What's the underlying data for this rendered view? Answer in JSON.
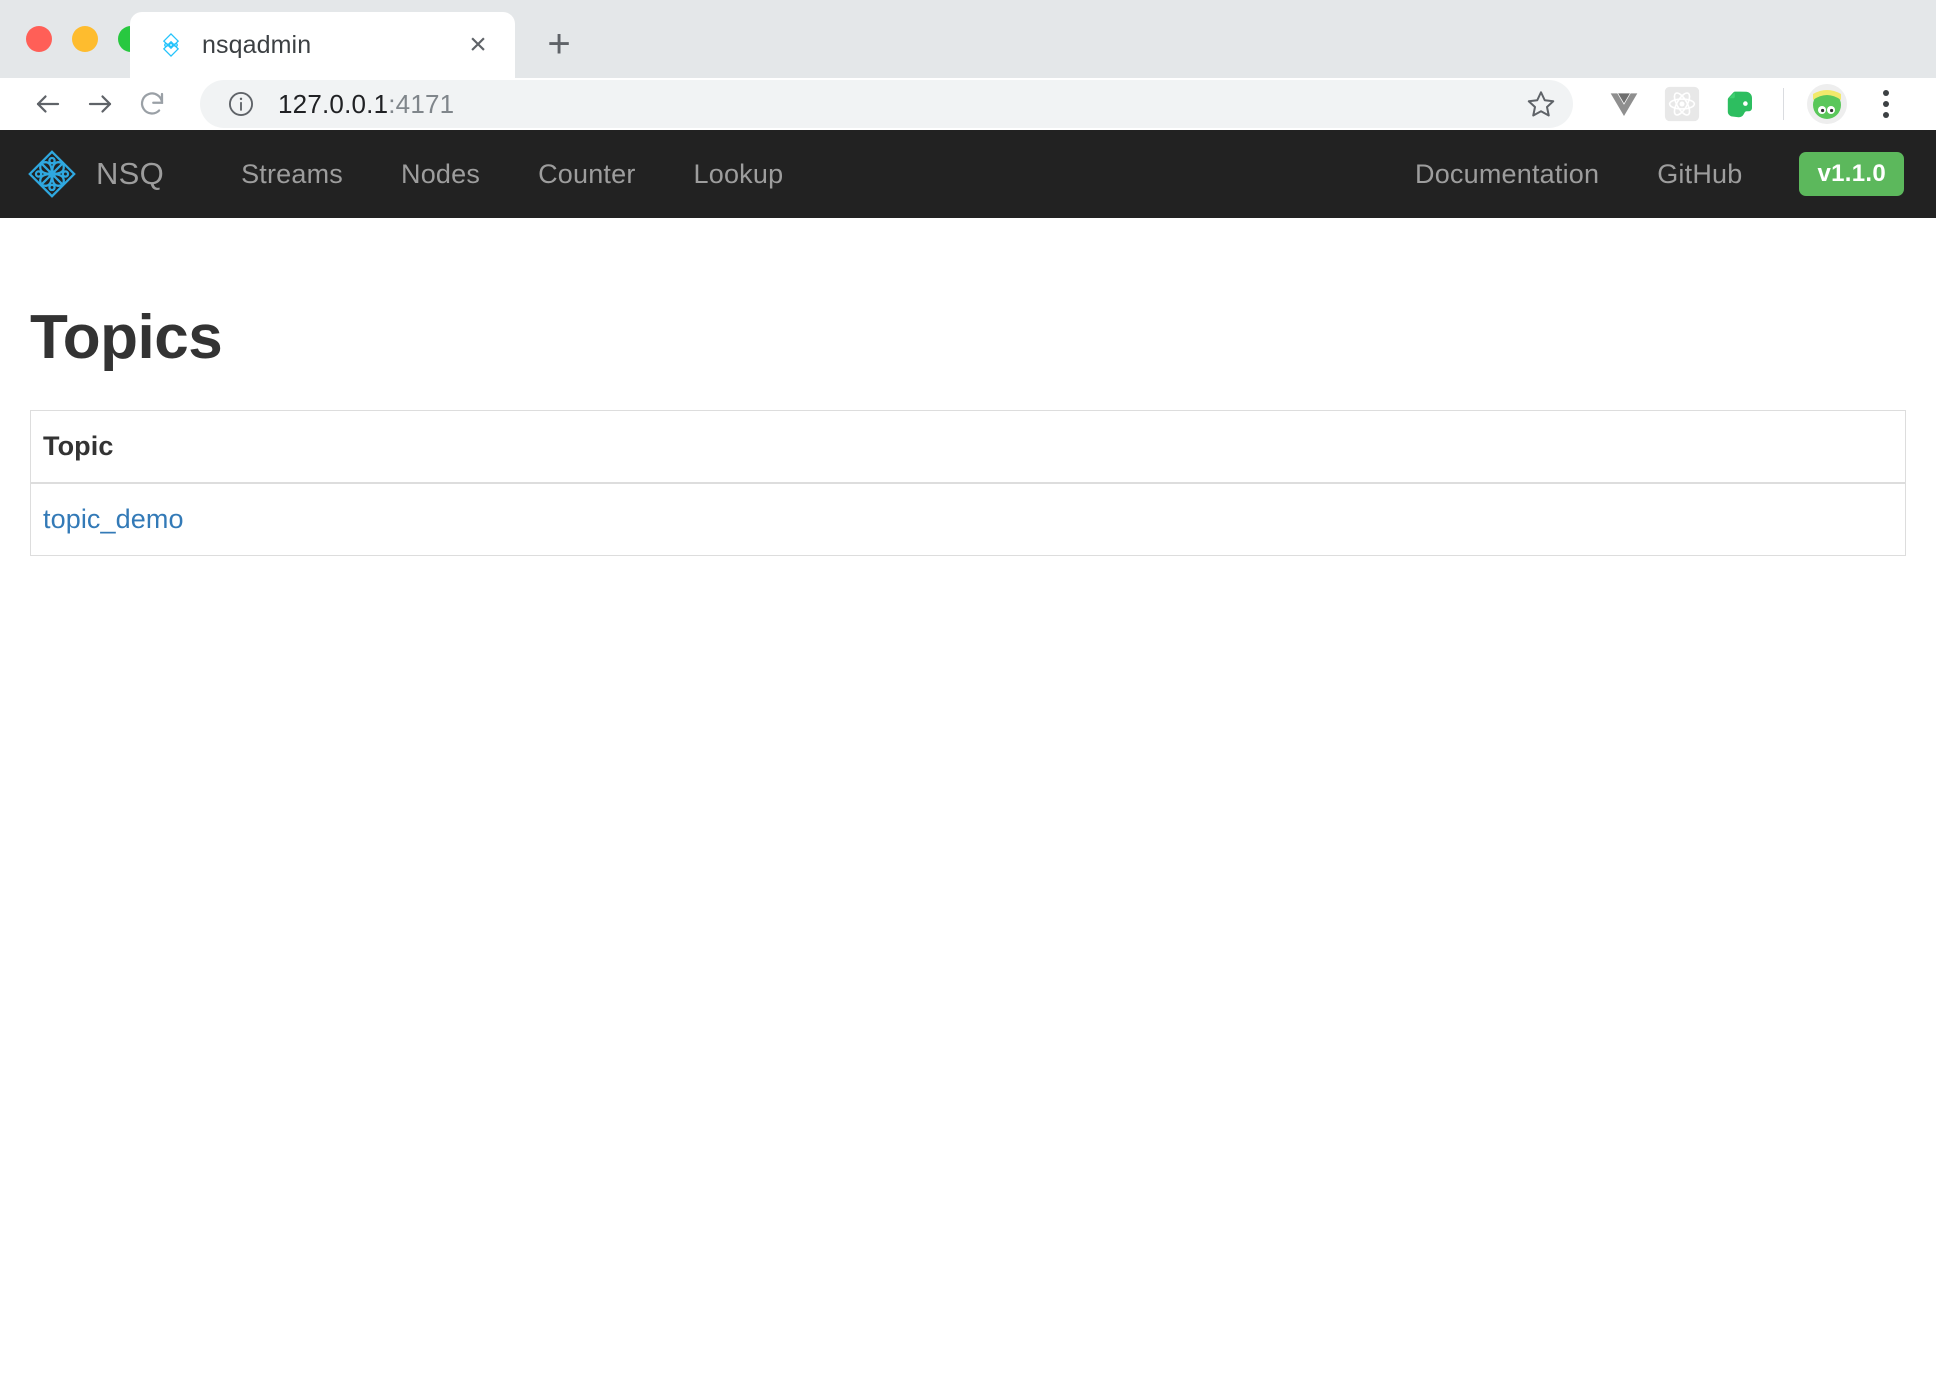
{
  "browser": {
    "window_controls": [
      {
        "name": "close",
        "color": "#ff5f57"
      },
      {
        "name": "minimize",
        "color": "#febc2e"
      },
      {
        "name": "maximize",
        "color": "#28c840"
      }
    ],
    "tab": {
      "title": "nsqadmin",
      "favicon": "nsq-diamond-icon",
      "close_label": "×"
    },
    "new_tab_label": "+",
    "toolbar": {
      "back_icon": "arrow-left-icon",
      "forward_icon": "arrow-right-icon",
      "reload_icon": "reload-icon",
      "security_icon": "info-circle-icon",
      "url_host": "127.0.0.1",
      "url_port": ":4171",
      "url_full": "127.0.0.1:4171",
      "bookmark_icon": "star-icon",
      "extensions": [
        {
          "name": "vue-devtools-icon",
          "color": "#8f8f8f"
        },
        {
          "name": "react-devtools-icon",
          "color": "#dcdcdc"
        },
        {
          "name": "evernote-icon",
          "color": "#2dbe60"
        },
        {
          "name": "profile-avatar",
          "color": "#5ac75a"
        }
      ],
      "menu_icon": "three-dot-menu-icon"
    }
  },
  "navbar": {
    "brand": {
      "logo_icon": "nsq-diamond-icon",
      "label": "NSQ",
      "logo_color": "#2fa8e0"
    },
    "links": [
      {
        "label": "Streams",
        "name": "nav-link-streams"
      },
      {
        "label": "Nodes",
        "name": "nav-link-nodes"
      },
      {
        "label": "Counter",
        "name": "nav-link-counter"
      },
      {
        "label": "Lookup",
        "name": "nav-link-lookup"
      }
    ],
    "right_links": [
      {
        "label": "Documentation",
        "name": "nav-link-documentation"
      },
      {
        "label": "GitHub",
        "name": "nav-link-github"
      }
    ],
    "version_badge": {
      "label": "v1.1.0",
      "color": "#5cb85c"
    },
    "background_color": "#222222",
    "text_color": "#9d9d9d"
  },
  "main": {
    "page_title": "Topics",
    "table": {
      "columns": [
        "Topic"
      ],
      "rows": [
        {
          "topic": "topic_demo"
        }
      ],
      "link_color": "#337ab7",
      "border_color": "#dddddd"
    }
  }
}
